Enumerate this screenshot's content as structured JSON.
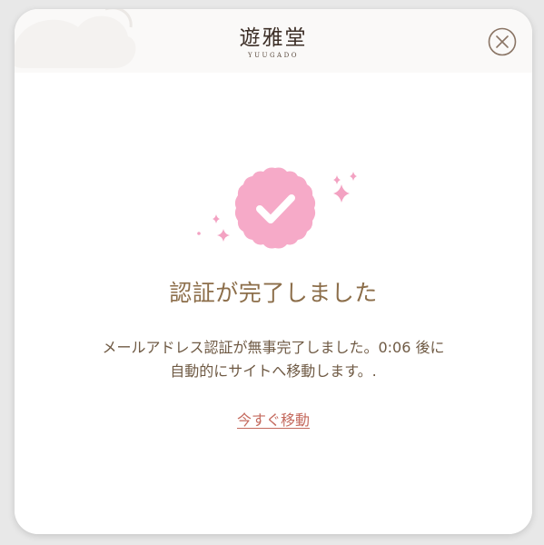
{
  "header": {
    "logo_title": "遊雅堂",
    "logo_subtitle": "YUUGADO",
    "close_icon": "close-circle-icon"
  },
  "main": {
    "verified_icon": "verified-badge-check-icon",
    "title": "認証が完了しました",
    "message_line1": "メールアドレス認証が無事完了しました。0:06 後に",
    "message_line2": "自動的にサイトへ移動します。.",
    "move_now_link": "今すぐ移動"
  },
  "colors": {
    "badge": "#f6aac8",
    "sparkle": "#f3a2c2",
    "title": "#8c6e4a",
    "link": "#c46a5e",
    "close": "#8a7565"
  }
}
